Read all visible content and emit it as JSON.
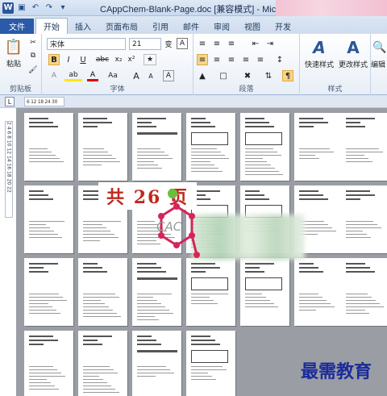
{
  "titlebar": {
    "doc_title": "CAppChem-Blank-Page.doc [兼容模式] - Microso",
    "qat_icons": [
      "word-icon",
      "save-icon",
      "undo-icon",
      "redo-icon",
      "customize-icon"
    ]
  },
  "tabs": [
    {
      "label": "文件",
      "kind": "file"
    },
    {
      "label": "开始",
      "kind": "active"
    },
    {
      "label": "插入"
    },
    {
      "label": "页面布局"
    },
    {
      "label": "引用"
    },
    {
      "label": "邮件"
    },
    {
      "label": "审阅"
    },
    {
      "label": "视图"
    },
    {
      "label": "开发"
    }
  ],
  "ribbon": {
    "clipboard": {
      "label": "剪贴板",
      "paste": "粘贴"
    },
    "font": {
      "label": "字体",
      "font_name": "宋体",
      "font_size": "21",
      "bold": "B",
      "italic": "I",
      "underline": "U",
      "strike": "abc",
      "subscript": "x₂",
      "superscript": "x²",
      "grow": "A",
      "shrink": "A",
      "case": "Aa",
      "highlight": "ab",
      "fontcolor": "A",
      "clear": "A"
    },
    "paragraph": {
      "label": "段落"
    },
    "styles": {
      "label": "样式",
      "quick": "快速样式",
      "change": "更改样式"
    },
    "editing": {
      "label": "编辑"
    }
  },
  "ruler": {
    "corner": "L",
    "h": "6 12 18 24 30",
    "v": "2 4 6 8 10 12 14 16 18 20 22"
  },
  "overlay": {
    "page_count": "共 26 页",
    "logo_text": "CAC",
    "watermark": "最需教育"
  }
}
